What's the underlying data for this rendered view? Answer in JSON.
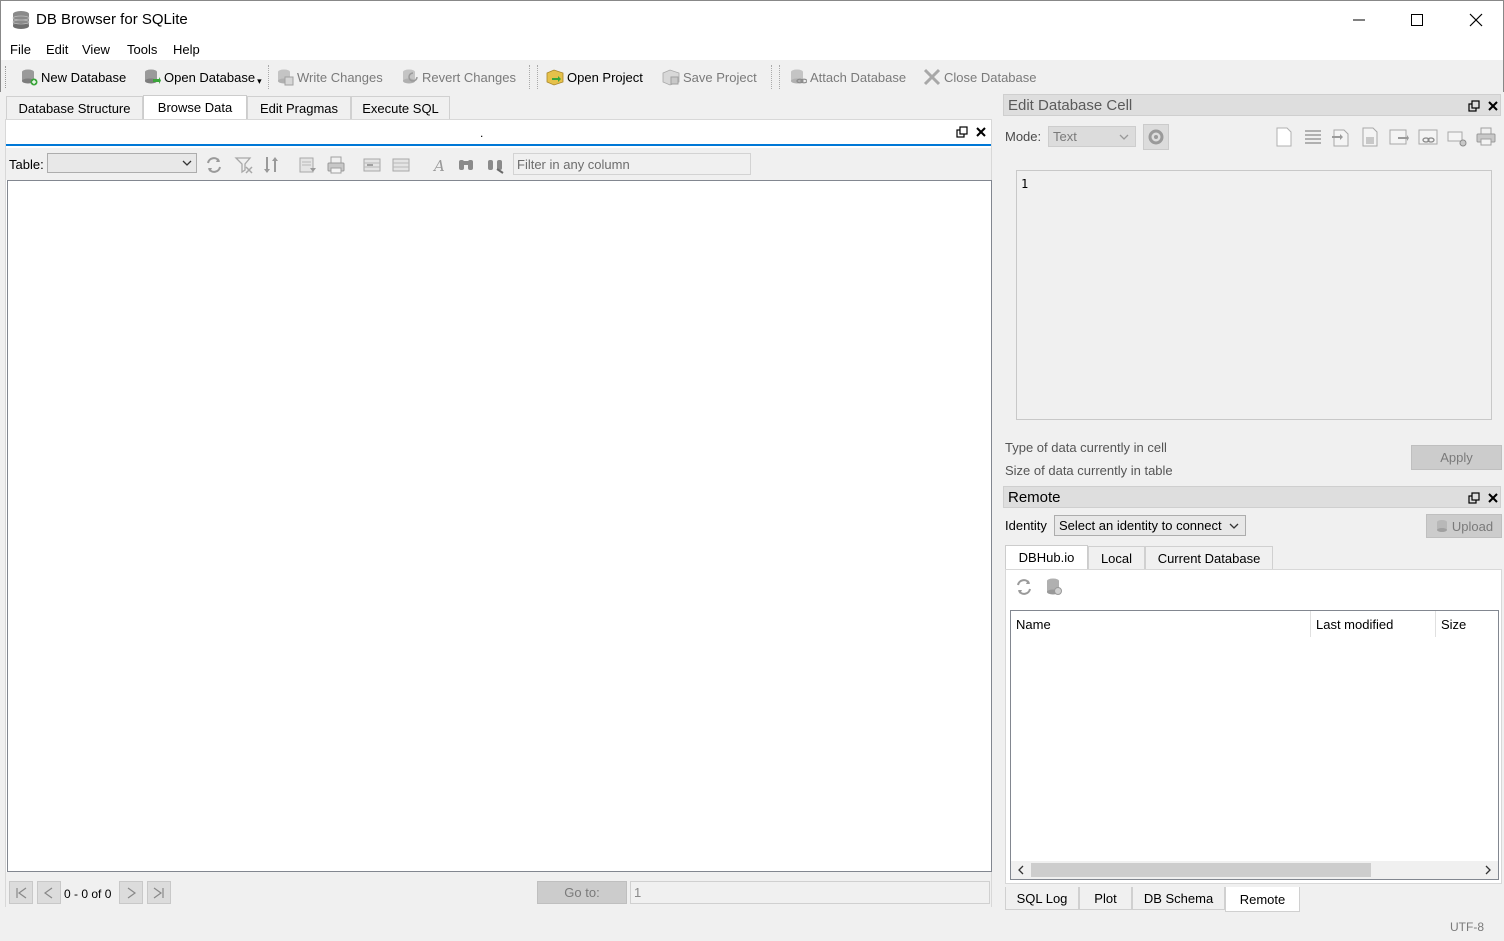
{
  "window": {
    "title": "DB Browser for SQLite"
  },
  "menu": [
    "File",
    "Edit",
    "View",
    "Tools",
    "Help"
  ],
  "toolbar": {
    "new_database": "New Database",
    "open_database": "Open Database",
    "write_changes": "Write Changes",
    "revert_changes": "Revert Changes",
    "open_project": "Open Project",
    "save_project": "Save Project",
    "attach_database": "Attach Database",
    "close_database": "Close Database"
  },
  "main_tabs": [
    "Database Structure",
    "Browse Data",
    "Edit Pragmas",
    "Execute SQL"
  ],
  "main_active_tab": "Browse Data",
  "browse": {
    "table_label": "Table:",
    "table_value": "",
    "filter_placeholder": "Filter in any column",
    "record_range": "0 - 0 of 0",
    "goto_label": "Go to:",
    "goto_value": "1",
    "header_dot": "."
  },
  "edit_cell": {
    "title": "Edit Database Cell",
    "mode_label": "Mode:",
    "mode_value": "Text",
    "content": "1",
    "type_info": "Type of data currently in cell",
    "size_info": "Size of data currently in table",
    "apply_label": "Apply"
  },
  "remote": {
    "title": "Remote",
    "identity_label": "Identity",
    "identity_value": "Select an identity to connect",
    "upload_label": "Upload",
    "tabs": [
      "DBHub.io",
      "Local",
      "Current Database"
    ],
    "active_tab": "DBHub.io",
    "columns": [
      "Name",
      "Last modified",
      "Size"
    ]
  },
  "bottom_tabs": [
    "SQL Log",
    "Plot",
    "DB Schema",
    "Remote"
  ],
  "bottom_active_tab": "Remote",
  "status": {
    "encoding": "UTF-8"
  },
  "colors": {
    "accent": "#0078d7",
    "disabled_text": "#7a7a7a",
    "panel_bg": "#f0f0f0"
  }
}
